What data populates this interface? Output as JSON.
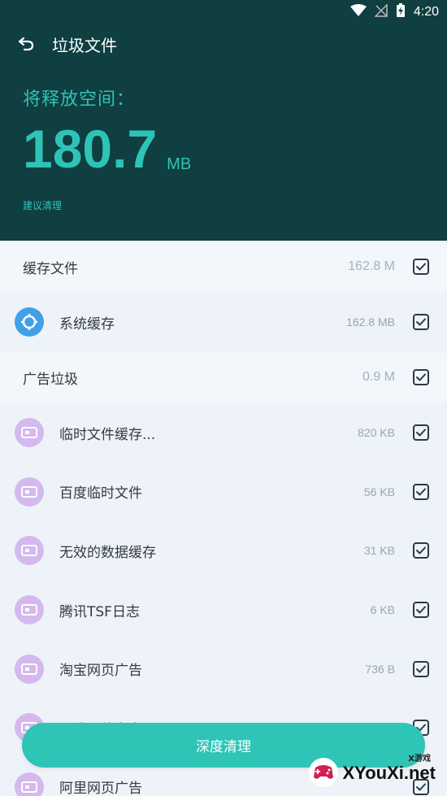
{
  "status": {
    "time": "4:20"
  },
  "header": {
    "title": "垃圾文件",
    "release_label": "将释放空间：",
    "size_value": "180.7",
    "size_unit": "MB",
    "suggest": "建议清理"
  },
  "groups": [
    {
      "title": "缓存文件",
      "size": "162.8 M",
      "items": [
        {
          "label": "系统缓存",
          "size": "162.8 MB",
          "icon": "gear-icon"
        }
      ]
    },
    {
      "title": "广告垃圾",
      "size": "0.9 M",
      "items": [
        {
          "label": "临时文件缓存...",
          "size": "820 KB",
          "icon": "ad-icon"
        },
        {
          "label": "百度临时文件",
          "size": "56 KB",
          "icon": "ad-icon"
        },
        {
          "label": "无效的数据缓存",
          "size": "31 KB",
          "icon": "ad-icon"
        },
        {
          "label": "腾讯TSF日志",
          "size": "6 KB",
          "icon": "ad-icon"
        },
        {
          "label": "淘宝网页广告",
          "size": "736 B",
          "icon": "ad-icon"
        },
        {
          "label": "可清理的淘宝",
          "size": "",
          "icon": "ad-icon"
        },
        {
          "label": "阿里网页广告",
          "size": "",
          "icon": "ad-icon"
        }
      ]
    }
  ],
  "actions": {
    "deep_clean": "深度清理"
  },
  "watermark": {
    "small": "X游戏",
    "big": "XYouXi.net"
  },
  "colors": {
    "header_bg": "#0f3f40",
    "accent": "#2fc3b8",
    "button": "#2ec4b6"
  }
}
